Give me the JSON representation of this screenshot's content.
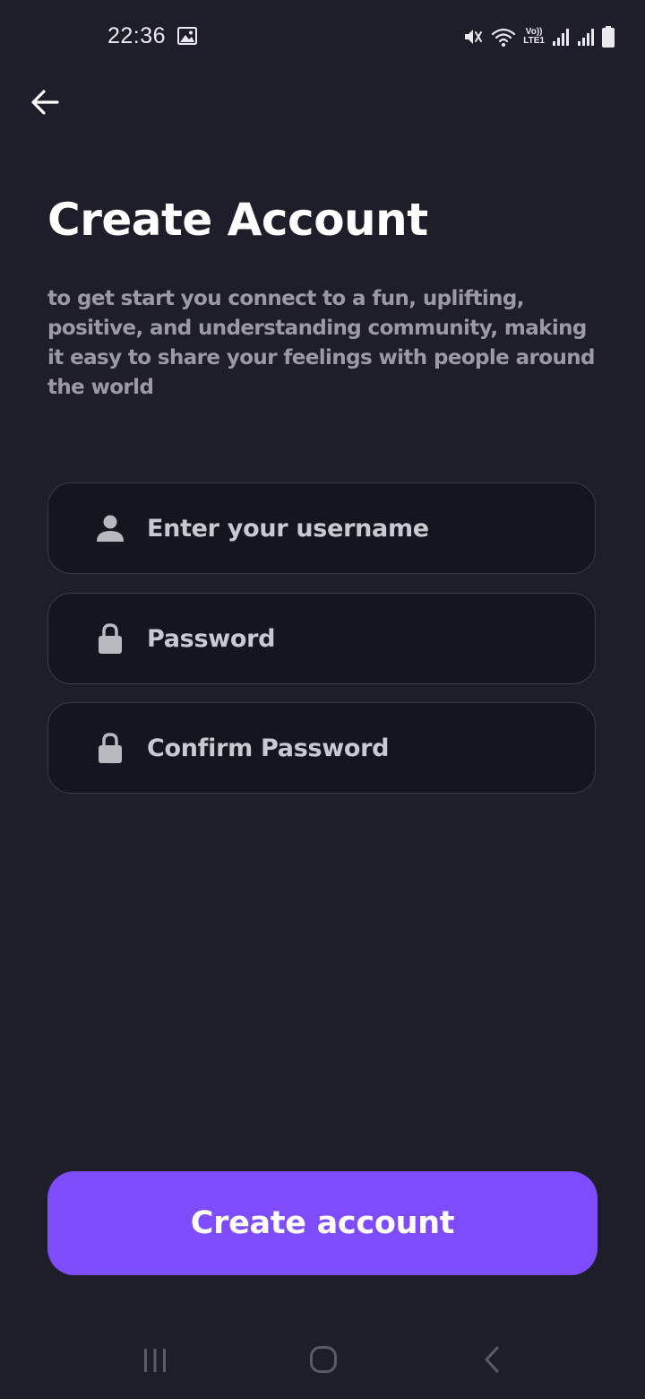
{
  "status_bar": {
    "time": "22:36",
    "volte_label": "Vo))",
    "lte_label": "LTE1",
    "icons": [
      "gallery-icon",
      "mute-icon",
      "wifi-icon",
      "signal-icon",
      "signal-icon",
      "battery-icon"
    ]
  },
  "header": {
    "back_icon": "arrow-left-icon"
  },
  "main": {
    "title": "Create Account",
    "subtitle": "to get start you connect to a fun, uplifting, positive, and understanding community, making it easy to share your feelings with people around the world",
    "fields": {
      "username": {
        "placeholder": "Enter your username",
        "value": "",
        "icon": "user-icon"
      },
      "password": {
        "placeholder": "Password",
        "value": "",
        "icon": "lock-icon"
      },
      "confirm_password": {
        "placeholder": "Confirm Password",
        "value": "",
        "icon": "lock-icon"
      }
    },
    "submit_label": "Create account"
  },
  "nav_bar": {
    "icons": [
      "recents-icon",
      "home-icon",
      "back-icon"
    ]
  },
  "colors": {
    "background": "#1e1e2b",
    "field_background": "#151520",
    "field_border": "#3a3a48",
    "accent": "#7f4cfb",
    "subtitle_text": "#9b9aa4",
    "icon_gray": "#b9b9c0"
  }
}
